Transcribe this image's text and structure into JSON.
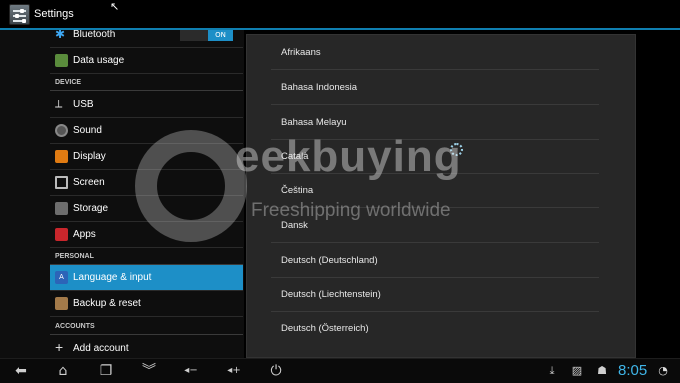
{
  "header": {
    "title": "Settings"
  },
  "sidebar": {
    "toggle_label": "ON",
    "items": [
      {
        "label": "Bluetooth"
      },
      {
        "label": "Data usage"
      },
      {
        "label": "USB"
      },
      {
        "label": "Sound"
      },
      {
        "label": "Display"
      },
      {
        "label": "Screen"
      },
      {
        "label": "Storage"
      },
      {
        "label": "Apps"
      },
      {
        "label": "Language & input"
      },
      {
        "label": "Backup & reset"
      },
      {
        "label": "Add account"
      }
    ],
    "sections": [
      "DEVICE",
      "PERSONAL",
      "ACCOUNTS"
    ]
  },
  "languages": [
    "Afrikaans",
    "Bahasa Indonesia",
    "Bahasa Melayu",
    "Català",
    "Čeština",
    "Dansk",
    "Deutsch (Deutschland)",
    "Deutsch (Liechtenstein)",
    "Deutsch (Österreich)"
  ],
  "watermark": {
    "title": "eekbuying",
    "subtitle": "Freeshipping worldwide"
  },
  "status": {
    "time": "8:05"
  },
  "colors": {
    "accent": "#1d8fc7",
    "clock": "#3fb5e8"
  }
}
